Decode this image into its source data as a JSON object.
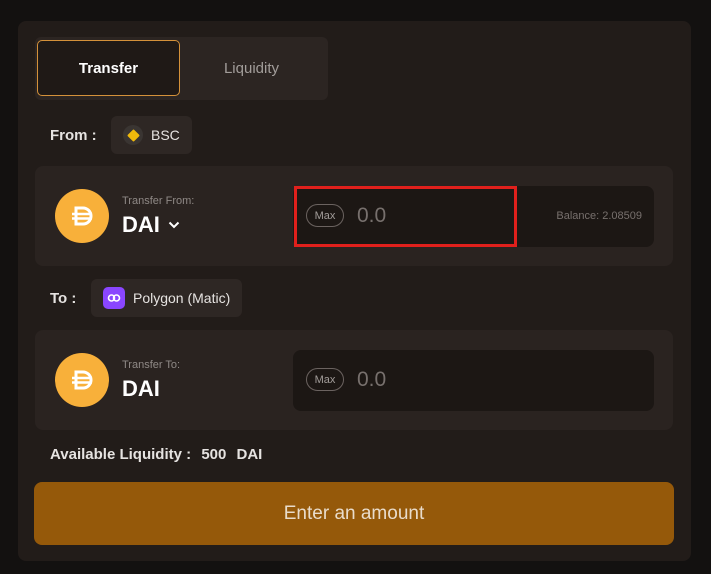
{
  "tabs": [
    {
      "label": "Transfer",
      "active": true
    },
    {
      "label": "Liquidity",
      "active": false
    }
  ],
  "from": {
    "label": "From :",
    "chain": {
      "name": "BSC",
      "icon": "bnb-chain-icon"
    }
  },
  "to": {
    "label": "To :",
    "chain": {
      "name": "Polygon (Matic)",
      "icon": "polygon-icon"
    }
  },
  "transfer_from": {
    "caption": "Transfer From:",
    "token": "DAI",
    "max_label": "Max",
    "amount_placeholder": "0.0",
    "balance": "Balance: 2.08509"
  },
  "transfer_to": {
    "caption": "Transfer To:",
    "token": "DAI",
    "max_label": "Max",
    "amount_placeholder": "0.0"
  },
  "liquidity": {
    "label": "Available Liquidity :",
    "value": "500",
    "unit": "DAI"
  },
  "cta_label": "Enter an amount",
  "colors": {
    "background": "#131110",
    "card": "#221c19",
    "accent": "#d4913a",
    "button": "#95590a",
    "dai": "#f8b03a",
    "bnb": "#f0b90b",
    "polygon": "#8a46ff",
    "highlight": "#e0201c"
  }
}
